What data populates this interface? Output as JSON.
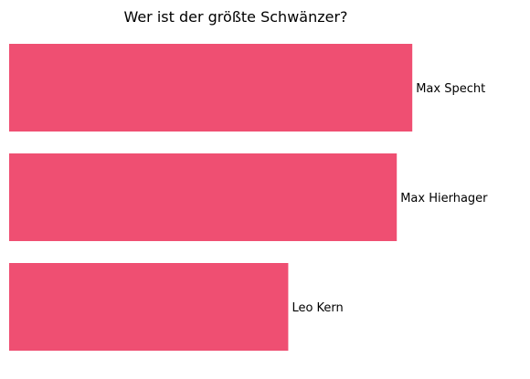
{
  "chart_data": {
    "type": "bar",
    "orientation": "horizontal",
    "title": "Wer ist der größte Schwänzer?",
    "categories": [
      "Max Specht",
      "Max Hierhager",
      "Leo Kern"
    ],
    "values": [
      26,
      25,
      18
    ],
    "xlim": [
      0,
      32
    ],
    "grid": false,
    "axes_visible": false,
    "bar_color": "#ef4f72"
  }
}
